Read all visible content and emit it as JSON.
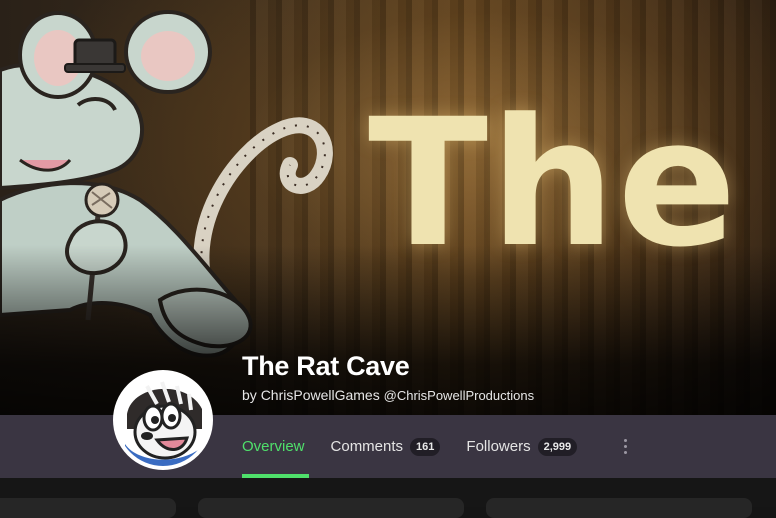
{
  "banner": {
    "image_description": "The Rat Cave",
    "visible_word": "The"
  },
  "profile": {
    "title": "The Rat Cave",
    "by_prefix": "by",
    "author": "ChrisPowellGames",
    "handle": "@ChrisPowellProductions"
  },
  "tabs": [
    {
      "label": "Overview",
      "count": null,
      "active": true
    },
    {
      "label": "Comments",
      "count": "161",
      "active": false
    },
    {
      "label": "Followers",
      "count": "2,999",
      "active": false
    }
  ],
  "colors": {
    "accent": "#4fe06b",
    "navbar": "#3a3542",
    "badge_bg": "#211e26"
  },
  "icons": {
    "more": "vertical-ellipsis-icon"
  }
}
